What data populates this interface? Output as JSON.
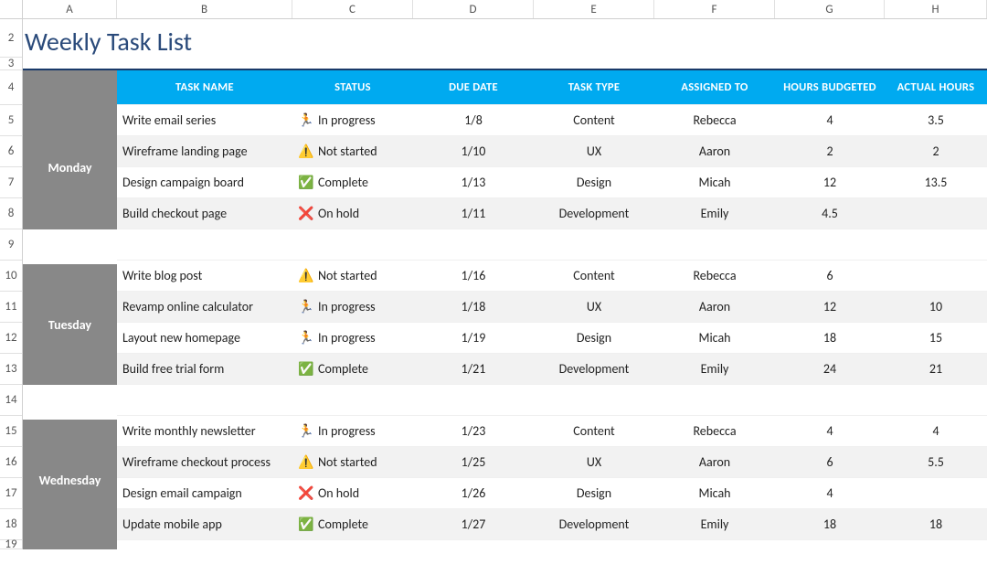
{
  "columns_letters": [
    "A",
    "B",
    "C",
    "D",
    "E",
    "F",
    "G",
    "H"
  ],
  "row_numbers": [
    "2",
    "3",
    "4",
    "5",
    "6",
    "7",
    "8",
    "9",
    "10",
    "11",
    "12",
    "13",
    "14",
    "15",
    "16",
    "17",
    "18",
    "19"
  ],
  "title": "Weekly Task List",
  "headers": {
    "task_name": "TASK NAME",
    "status": "STATUS",
    "due_date": "DUE DATE",
    "task_type": "TASK TYPE",
    "assigned_to": "ASSIGNED TO",
    "hours_budgeted": "HOURS BUDGETED",
    "actual_hours": "ACTUAL HOURS"
  },
  "status_icons": {
    "in_progress": "🏃",
    "not_started": "⚠️",
    "complete": "✅",
    "on_hold": "❌"
  },
  "status_labels": {
    "in_progress": "In progress",
    "not_started": "Not started",
    "complete": "Complete",
    "on_hold": "On hold"
  },
  "days": [
    {
      "name": "Monday",
      "tasks": [
        {
          "name": "Write email series",
          "status": "in_progress",
          "due": "1/8",
          "type": "Content",
          "assigned": "Rebecca",
          "budget": "4",
          "actual": "3.5"
        },
        {
          "name": "Wireframe landing page",
          "status": "not_started",
          "due": "1/10",
          "type": "UX",
          "assigned": "Aaron",
          "budget": "2",
          "actual": "2"
        },
        {
          "name": "Design campaign board",
          "status": "complete",
          "due": "1/13",
          "type": "Design",
          "assigned": "Micah",
          "budget": "12",
          "actual": "13.5"
        },
        {
          "name": "Build checkout page",
          "status": "on_hold",
          "due": "1/11",
          "type": "Development",
          "assigned": "Emily",
          "budget": "4.5",
          "actual": ""
        }
      ]
    },
    {
      "name": "Tuesday",
      "tasks": [
        {
          "name": "Write blog post",
          "status": "not_started",
          "due": "1/16",
          "type": "Content",
          "assigned": "Rebecca",
          "budget": "6",
          "actual": ""
        },
        {
          "name": "Revamp online calculator",
          "status": "in_progress",
          "due": "1/18",
          "type": "UX",
          "assigned": "Aaron",
          "budget": "12",
          "actual": "10"
        },
        {
          "name": "Layout new homepage",
          "status": "in_progress",
          "due": "1/19",
          "type": "Design",
          "assigned": "Micah",
          "budget": "18",
          "actual": "15"
        },
        {
          "name": "Build free trial form",
          "status": "complete",
          "due": "1/21",
          "type": "Development",
          "assigned": "Emily",
          "budget": "24",
          "actual": "21"
        }
      ]
    },
    {
      "name": "Wednesday",
      "tasks": [
        {
          "name": "Write monthly newsletter",
          "status": "in_progress",
          "due": "1/23",
          "type": "Content",
          "assigned": "Rebecca",
          "budget": "4",
          "actual": "4"
        },
        {
          "name": "Wireframe checkout process",
          "status": "not_started",
          "due": "1/25",
          "type": "UX",
          "assigned": "Aaron",
          "budget": "6",
          "actual": "5.5"
        },
        {
          "name": "Design email campaign",
          "status": "on_hold",
          "due": "1/26",
          "type": "Design",
          "assigned": "Micah",
          "budget": "4",
          "actual": ""
        },
        {
          "name": "Update mobile app",
          "status": "complete",
          "due": "1/27",
          "type": "Development",
          "assigned": "Emily",
          "budget": "18",
          "actual": "18"
        }
      ]
    }
  ],
  "row_heights": {
    "title": 42,
    "underline": 14,
    "header": 38,
    "data": 34,
    "spacer": 34,
    "partial": 10
  }
}
